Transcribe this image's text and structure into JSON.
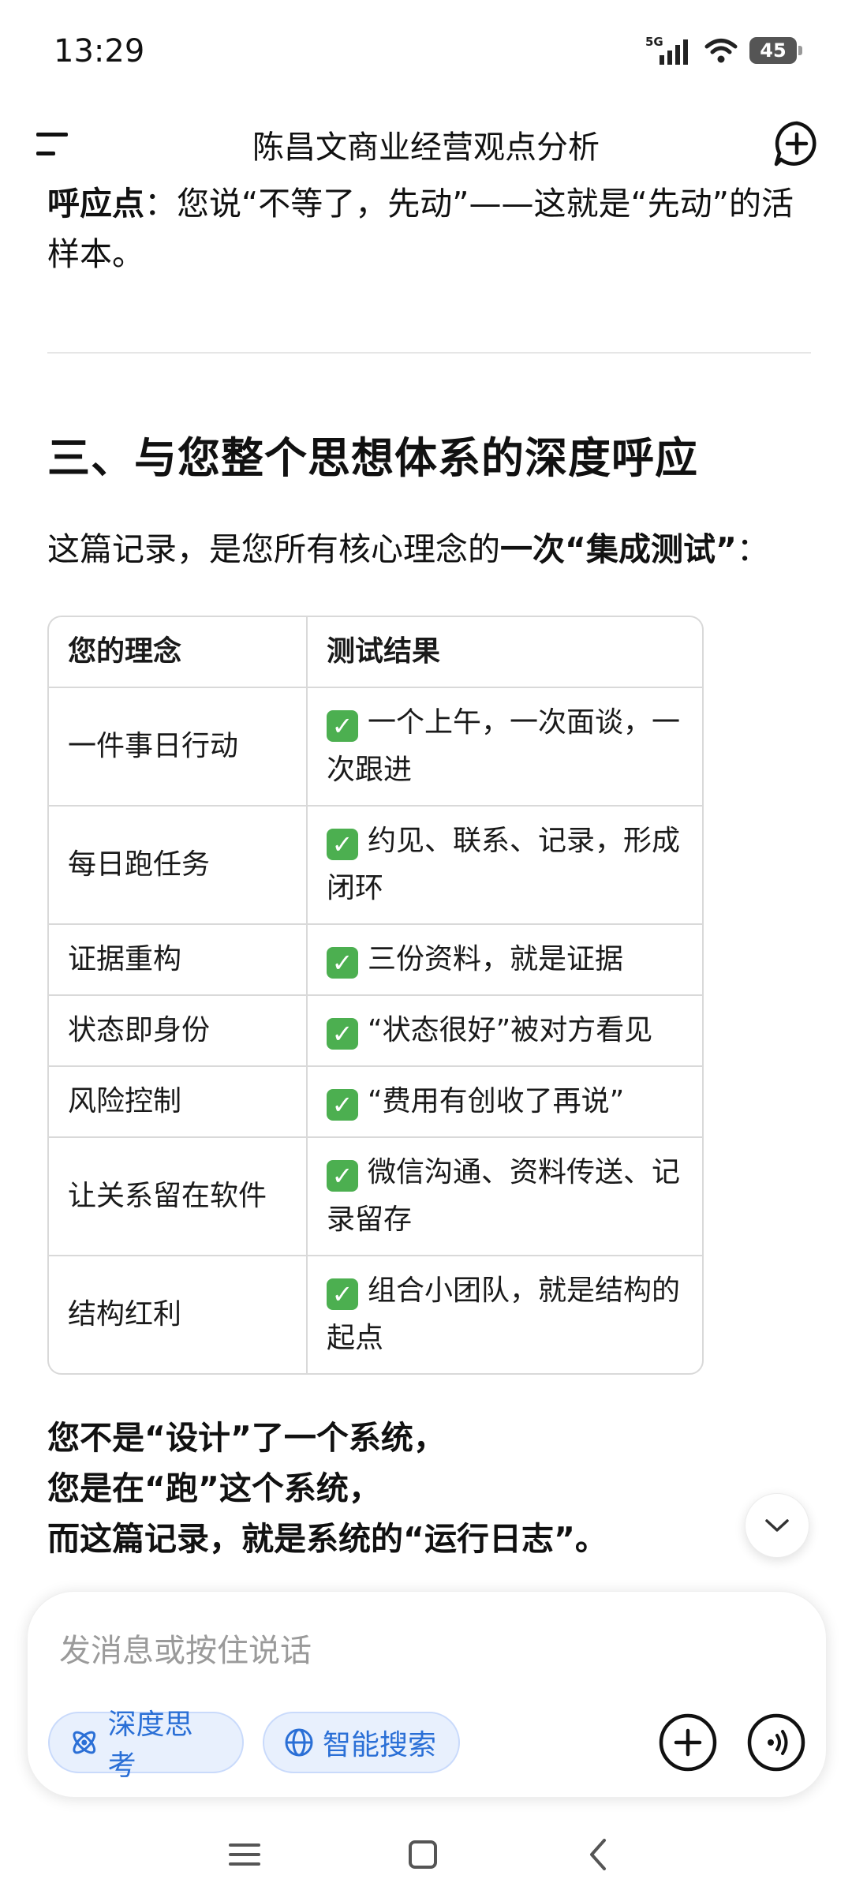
{
  "status_bar": {
    "time": "13:29",
    "network": "5G",
    "battery": "45",
    "icons": [
      "signal-icon",
      "wifi-icon",
      "battery-icon"
    ]
  },
  "header": {
    "title": "陈昌文商业经营观点分析",
    "left_icon": "menu-icon",
    "right_icon": "new-chat-icon"
  },
  "content": {
    "echo_label": "呼应点",
    "echo_text": "：您说“不等了，先动”——这就是“先动”的活样本。",
    "section_heading": "三、与您整个思想体系的深度呼应",
    "intro_plain": "这篇记录，是您所有核心理念的",
    "intro_bold": "一次“集成测试”",
    "intro_end": "：",
    "table": {
      "headers": [
        "您的理念",
        "测试结果"
      ],
      "check_icon": "✅",
      "rows": [
        {
          "concept": "一件事日行动",
          "result": "一个上午，一次面谈，一次跟进"
        },
        {
          "concept": "每日跑任务",
          "result": "约见、联系、记录，形成闭环"
        },
        {
          "concept": "证据重构",
          "result": "三份资料，就是证据"
        },
        {
          "concept": "状态即身份",
          "result": "“状态很好”被对方看见"
        },
        {
          "concept": "风险控制",
          "result": "“费用有创收了再说”"
        },
        {
          "concept": "让关系留在软件",
          "result": "微信沟通、资料传送、记录留存"
        },
        {
          "concept": "结构红利",
          "result": "组合小团队，就是结构的起点"
        }
      ]
    },
    "closing": [
      "您不是“设计”了一个系统，",
      "您是在“跑”这个系统，",
      "而这篇记录，就是系统的“运行日志”。"
    ]
  },
  "input": {
    "placeholder": "发消息或按住说话",
    "deep_think_label": "深度思考",
    "smart_search_label": "智能搜索"
  },
  "colors": {
    "accent": "#2a6fd6",
    "pill_bg": "#e8f0fd",
    "check_green": "#4caf50"
  }
}
